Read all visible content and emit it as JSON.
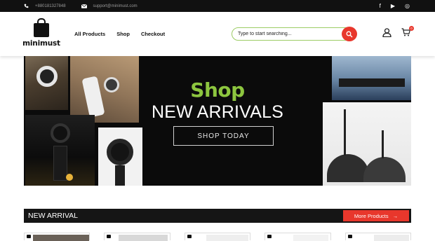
{
  "topbar": {
    "phone": "+880181327848",
    "email": "support@minimust.com",
    "social": [
      "f",
      "▶",
      "◎"
    ]
  },
  "header": {
    "brand": "minimust",
    "nav": [
      "All Products",
      "Shop",
      "Checkout"
    ],
    "search_placeholder": "Type to start searching...",
    "cart_count": "0"
  },
  "hero": {
    "shop": "Shop",
    "title": "NEW ARRIVALS",
    "button": "SHOP TODAY"
  },
  "arrival": {
    "title": "NEW ARRIVAL",
    "more": "More Products",
    "more_arrow": "→"
  },
  "colors": {
    "accent": "#e8372c",
    "green": "#8dc63f",
    "dark": "#111111"
  }
}
